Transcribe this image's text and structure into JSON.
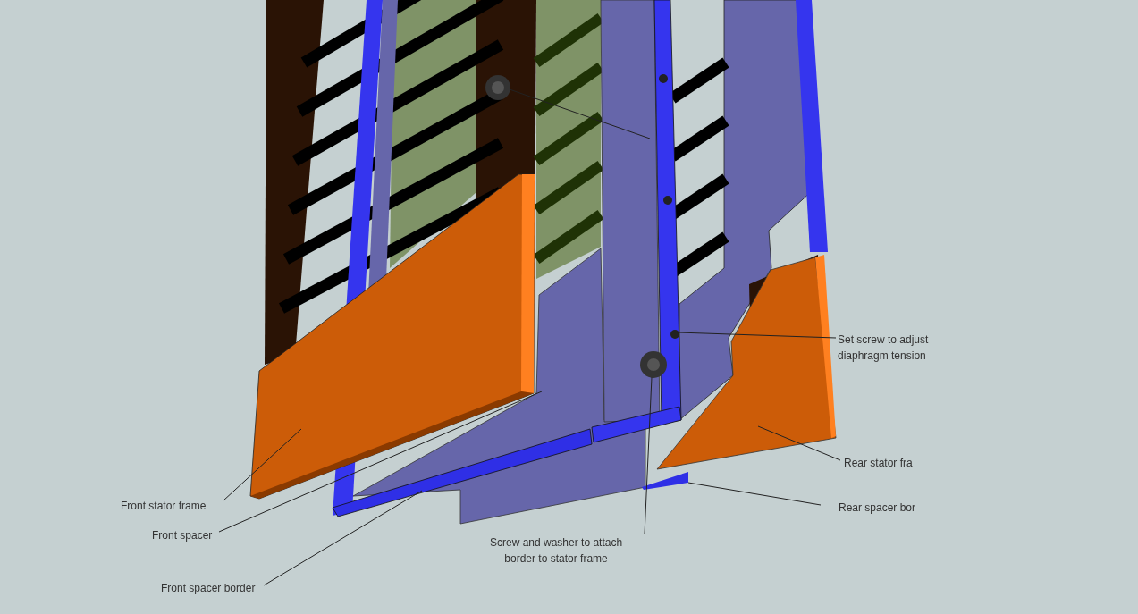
{
  "callouts": [
    {
      "kind": "right",
      "lines": [
        "Set screw to adjust",
        "diaphragm tension"
      ]
    },
    {
      "kind": "right",
      "lines": [
        "Rear stator fra"
      ]
    },
    {
      "kind": "right",
      "lines": [
        "Rear spacer bor"
      ]
    },
    {
      "kind": "center",
      "lines": [
        "Screw and washer to attach",
        "border to stator frame"
      ]
    },
    {
      "kind": "left",
      "lines": [
        "Front stator frame"
      ]
    },
    {
      "kind": "left",
      "lines": [
        "Front spacer"
      ]
    },
    {
      "kind": "left",
      "lines": [
        "Front spacer border"
      ]
    }
  ]
}
